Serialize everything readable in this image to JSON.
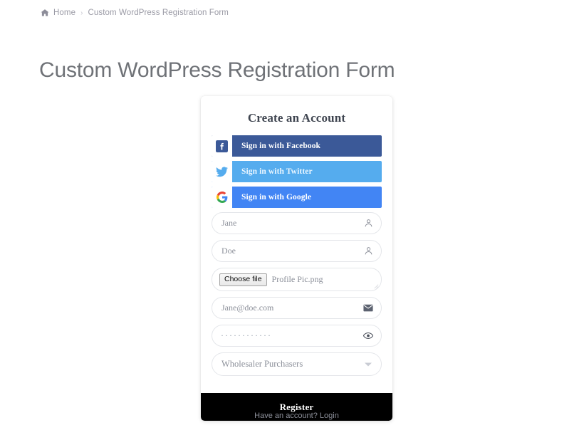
{
  "breadcrumb": {
    "home_icon": "home-icon",
    "home_label": "Home",
    "separator": "›",
    "current": "Custom WordPress Registration Form"
  },
  "page": {
    "title": "Custom WordPress Registration Form"
  },
  "card": {
    "heading": "Create an Account",
    "social_buttons": [
      {
        "label": "Sign in with Facebook",
        "icon": "facebook-icon",
        "color": "#3b5998"
      },
      {
        "label": "Sign in with Twitter",
        "icon": "twitter-icon",
        "color": "#55acee"
      },
      {
        "label": "Sign in with Google",
        "icon": "google-icon",
        "color": "#4285f4"
      }
    ],
    "fields": {
      "first_name": {
        "value": "Jane",
        "placeholder": "Jane",
        "icon": "person-icon"
      },
      "last_name": {
        "value": "Doe",
        "placeholder": "Doe",
        "icon": "person-icon"
      },
      "profile_pic": {
        "button_label": "Choose file",
        "file_name": "Profile Pic.png",
        "icon": "resize-grip-icon"
      },
      "email": {
        "value": "Jane@doe.com",
        "placeholder": "Jane@doe.com",
        "icon": "envelope-icon"
      },
      "password": {
        "masked_value": "············",
        "icon": "eye-icon"
      },
      "user_role": {
        "selected": "Wholesaler Purchasers",
        "icon": "chevron-down-icon"
      }
    },
    "submit_label": "Register",
    "footer_text": "Have an account? ",
    "footer_link": "Login"
  }
}
